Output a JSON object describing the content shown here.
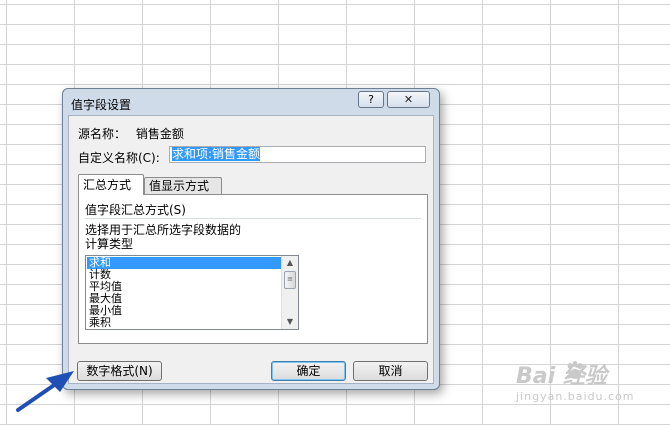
{
  "dialog": {
    "title": "值字段设置",
    "help_symbol": "?",
    "close_symbol": "✕",
    "source_label": "源名称：",
    "source_value": "销售金额",
    "custom_name_label": "自定义名称(C):",
    "custom_name_value": "求和项:销售金额",
    "tabs": [
      {
        "label": "汇总方式",
        "active": true
      },
      {
        "label": "值显示方式",
        "active": false
      }
    ],
    "group_title": "值字段汇总方式(S)",
    "description_line1": "选择用于汇总所选字段数据的",
    "description_line2": "计算类型",
    "list_items": [
      "求和",
      "计数",
      "平均值",
      "最大值",
      "最小值",
      "乘积"
    ],
    "selected_item": "求和",
    "buttons": {
      "number_format": "数字格式(N)",
      "ok": "确定",
      "cancel": "取消"
    }
  },
  "watermark": {
    "main": "Bai   经验",
    "sub": "jingyan.baidu.com"
  },
  "colors": {
    "selection": "#3399ff",
    "dialog_frame": "#cfdbe9",
    "arrow": "#1f4fb4"
  }
}
